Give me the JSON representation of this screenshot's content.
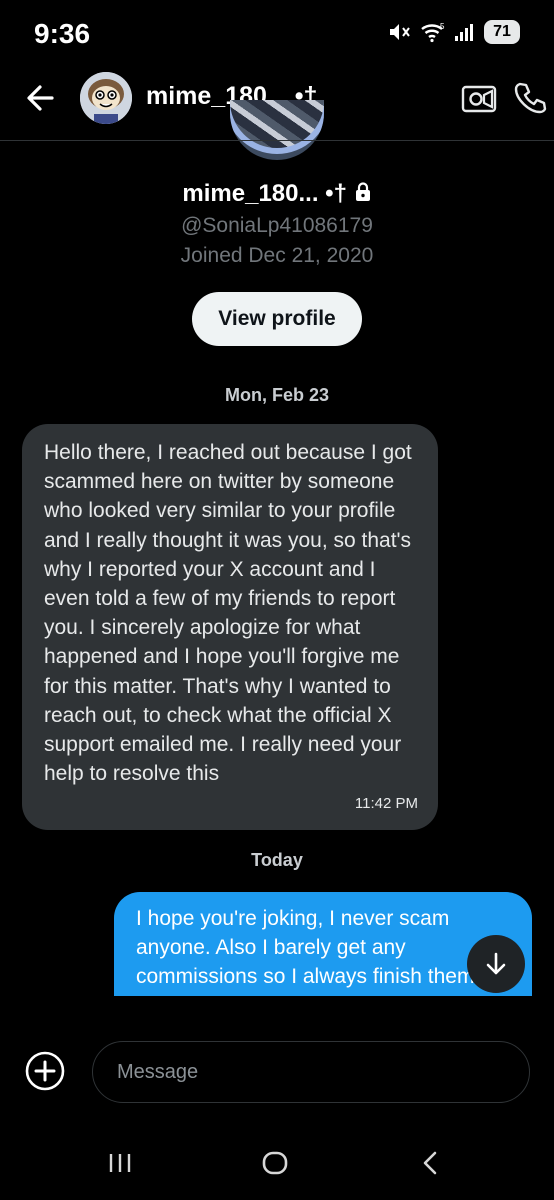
{
  "status_bar": {
    "time": "9:36",
    "battery": "71"
  },
  "header": {
    "name": "mime_180... •†"
  },
  "profile": {
    "name": "mime_180... •†",
    "handle": "@SoniaLp41086179",
    "joined": "Joined Dec 21, 2020",
    "view_profile_label": "View profile"
  },
  "conversation": {
    "date_separators": [
      "Mon, Feb 23",
      "Today"
    ],
    "messages": [
      {
        "direction": "incoming",
        "text": "Hello there, I reached out because I got scammed here on twitter by someone who looked very similar to your profile and I really thought it was you, so that's why I reported your X account and I even told a few of my friends to report you. I sincerely apologize for what happened and I hope you'll forgive me for this matter. That's why I wanted to reach out, to check what the official X support emailed me. I really need your help to resolve this",
        "time": "11:42 PM"
      },
      {
        "direction": "outgoing",
        "text": "I hope you're joking, I never scam anyone. Also I barely get any commissions so I always finish them on time. I do art for fun and this is my"
      }
    ]
  },
  "composer": {
    "placeholder": "Message"
  },
  "icons": {
    "back": "arrow-left-icon",
    "video": "video-call-icon",
    "phone": "phone-icon",
    "lock": "lock-icon",
    "add": "plus-circle-icon",
    "scroll": "arrow-down-icon"
  },
  "colors": {
    "background": "#000000",
    "incoming_bubble": "#2f3336",
    "outgoing_bubble": "#1d9bf0",
    "secondary_text": "#71767b"
  }
}
